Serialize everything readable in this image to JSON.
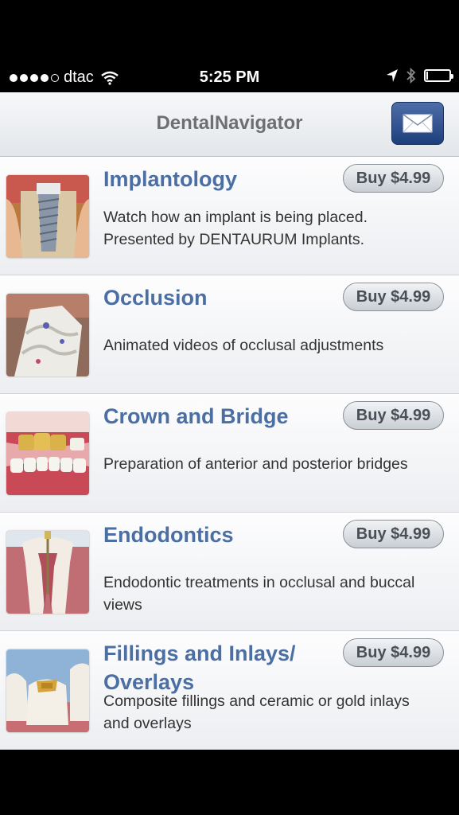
{
  "status_bar": {
    "carrier": "dtac",
    "time": "5:25 PM",
    "signal_bars": 4,
    "signal_max": 5,
    "battery_level": 0.08
  },
  "header": {
    "title": "DentalNavigator",
    "mail_icon": "envelope-icon",
    "accent": "#2b4f8f"
  },
  "items": [
    {
      "title": "Implantology",
      "buy_label": "Buy $4.99",
      "description": "Watch how an implant is being placed. Presented by DENTAURUM Implants.",
      "thumbnail": "implant-thumbnail"
    },
    {
      "title": "Occlusion",
      "buy_label": "Buy $4.99",
      "description": "Animated videos of occlusal adjustments",
      "thumbnail": "occlusion-thumbnail"
    },
    {
      "title": "Crown and Bridge",
      "buy_label": "Buy $4.99",
      "description": "Preparation of anterior and posterior bridges",
      "thumbnail": "crown-bridge-thumbnail"
    },
    {
      "title": "Endodontics",
      "buy_label": "Buy $4.99",
      "description": "Endodontic treatments in occlusal and buccal views",
      "thumbnail": "endodontics-thumbnail"
    },
    {
      "title": "Fillings and Inlays/ Overlays",
      "buy_label": "Buy $4.99",
      "description": "Composite fillings and ceramic or gold inlays and overlays",
      "thumbnail": "fillings-thumbnail"
    }
  ]
}
